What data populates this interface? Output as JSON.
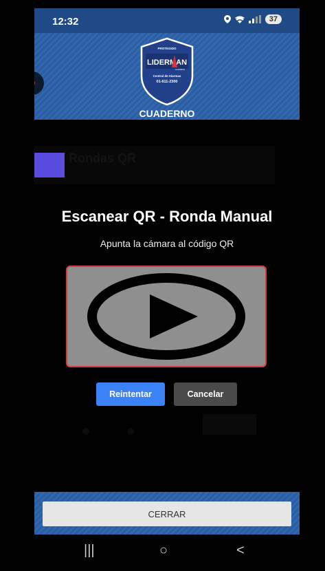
{
  "status_bar": {
    "time": "12:32",
    "battery": "37",
    "icons": [
      "location-icon",
      "wifi-icon",
      "signal-icon"
    ]
  },
  "header": {
    "badge": {
      "top_text": "PROTEGIDO",
      "brand": "LIDERMAN",
      "brand_sub": "ALARMAS",
      "line1": "Central de Alarmas",
      "phone": "01-611-2300"
    },
    "title": "CUADERNO"
  },
  "background": {
    "label": "Rondas QR",
    "swatch_color": "#5b4ce0"
  },
  "modal": {
    "title": "Escanear QR - Ronda Manual",
    "subtitle": "Apunta la cámara al código QR",
    "camera_icon": "play-icon",
    "retry_label": "Reintentar",
    "cancel_label": "Cancelar",
    "accent": "#3b82f6",
    "frame_color": "#d63a3a"
  },
  "bottom": {
    "close_label": "CERRAR"
  },
  "navbar": {
    "recents": "|||",
    "home": "○",
    "back": "<"
  }
}
